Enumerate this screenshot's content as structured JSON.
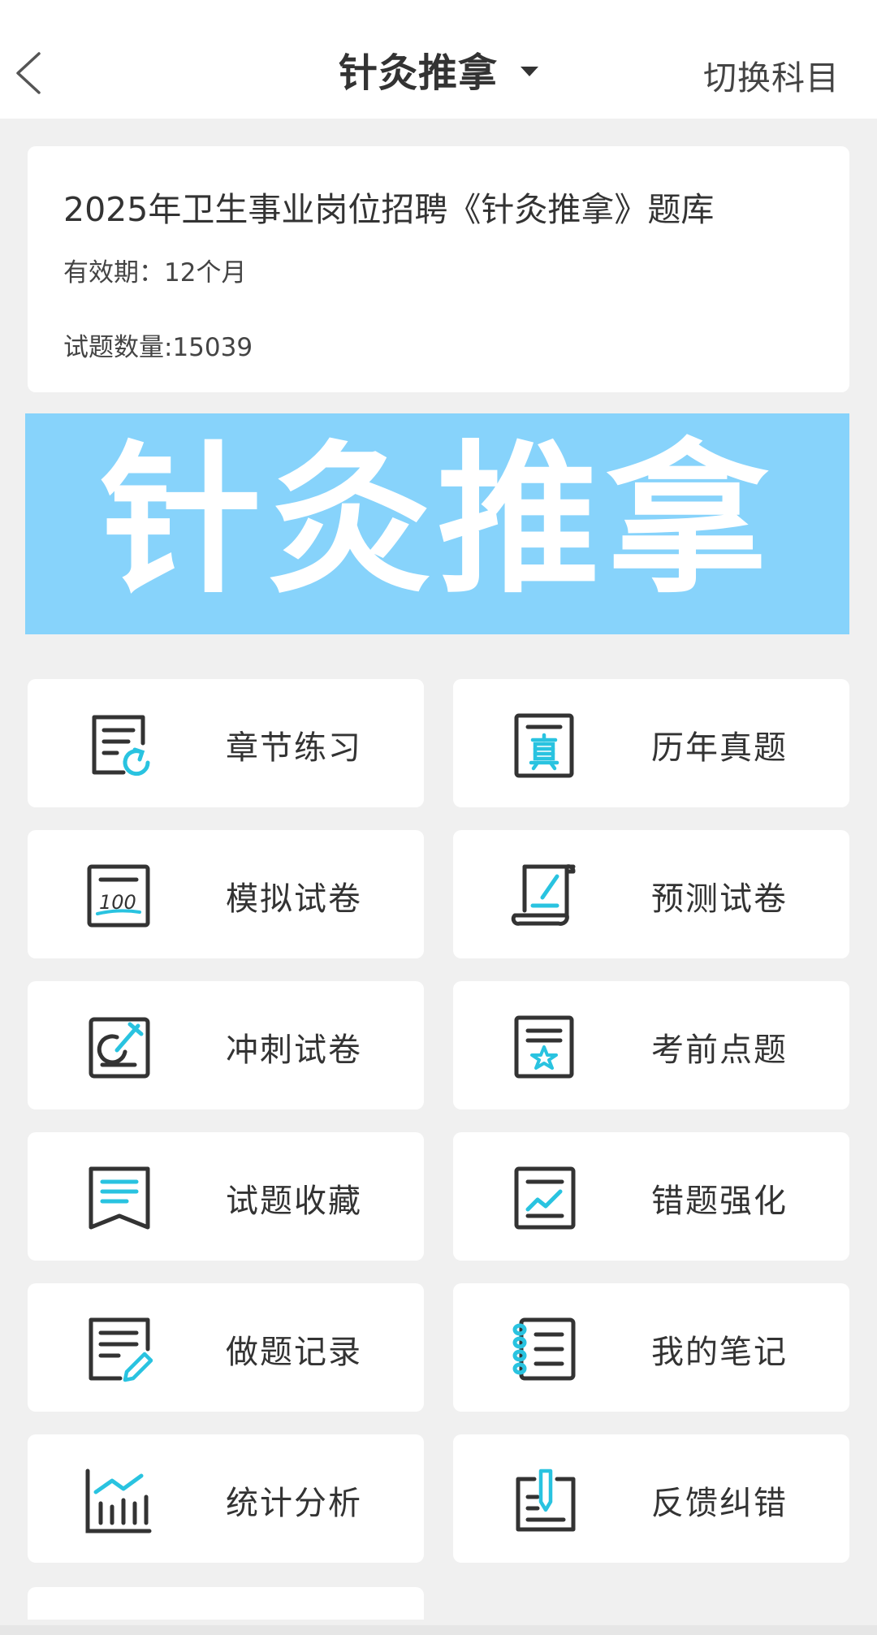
{
  "header": {
    "title": "针灸推拿",
    "switch_label": "切换科目"
  },
  "info": {
    "title": "2025年卫生事业岗位招聘《针灸推拿》题库",
    "validity": "有效期：12个月",
    "question_count": "试题数量:15039"
  },
  "banner": {
    "text": "针灸推拿"
  },
  "colors": {
    "accent": "#29c3e0",
    "banner_bg": "#87d3fb",
    "icon_stroke": "#333333"
  },
  "menu": [
    {
      "label": "章节练习",
      "icon": "chapter-practice-icon"
    },
    {
      "label": "历年真题",
      "icon": "past-exams-icon"
    },
    {
      "label": "模拟试卷",
      "icon": "mock-exam-icon"
    },
    {
      "label": "预测试卷",
      "icon": "prediction-exam-icon"
    },
    {
      "label": "冲刺试卷",
      "icon": "sprint-exam-icon"
    },
    {
      "label": "考前点题",
      "icon": "pre-exam-tips-icon"
    },
    {
      "label": "试题收藏",
      "icon": "favorites-icon"
    },
    {
      "label": "错题强化",
      "icon": "wrong-questions-icon"
    },
    {
      "label": "做题记录",
      "icon": "practice-record-icon"
    },
    {
      "label": "我的笔记",
      "icon": "my-notes-icon"
    },
    {
      "label": "统计分析",
      "icon": "statistics-icon"
    },
    {
      "label": "反馈纠错",
      "icon": "feedback-icon"
    }
  ]
}
